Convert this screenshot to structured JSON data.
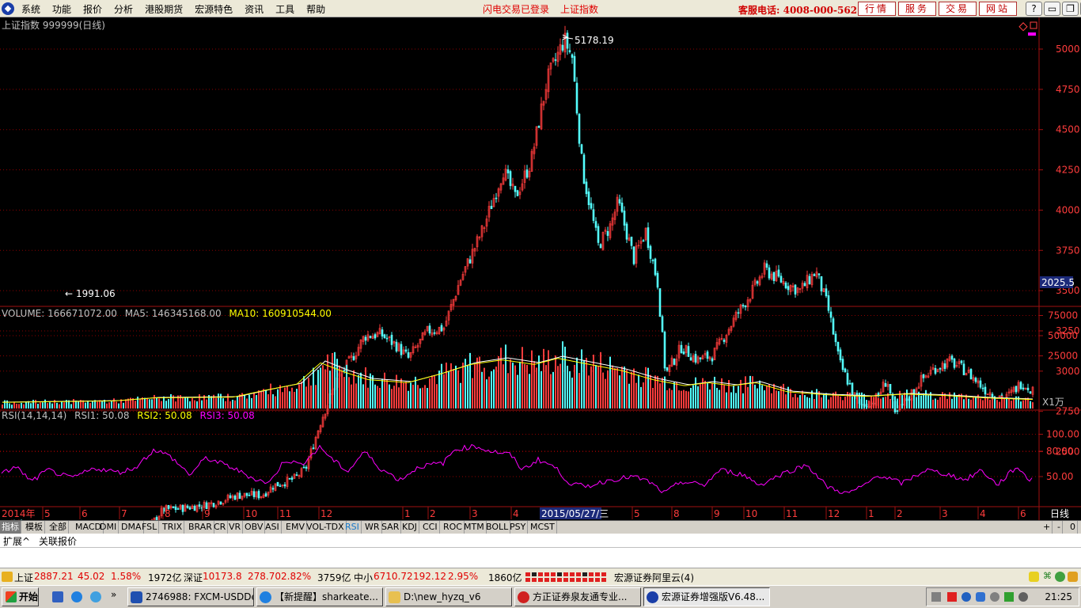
{
  "menu": {
    "items": [
      "系统",
      "功能",
      "报价",
      "分析",
      "港股期货",
      "宏源特色",
      "资讯",
      "工具",
      "帮助"
    ],
    "login_status": "闪电交易已登录",
    "current_index": "上证指数",
    "hotline": "客服电话: 4008-000-562",
    "nav_buttons": [
      "行情",
      "服务",
      "交易",
      "网站"
    ],
    "window_controls": [
      "?",
      "▭",
      "❐",
      "✕"
    ]
  },
  "kline": {
    "title": "上证指数 999999(日线)",
    "high_label": "5178.19",
    "low_label": "1991.06",
    "current_tag": "2025.5",
    "y_ticks": [
      "5000",
      "4750",
      "4500",
      "4250",
      "4000",
      "3750",
      "3500",
      "3250",
      "3000",
      "2750",
      "2500",
      "2000"
    ]
  },
  "volume": {
    "label_volume": "VOLUME: 166671072.00",
    "label_ma5": "MA5: 146345168.00",
    "label_ma10": "MA10: 160910544.00",
    "y_ticks": [
      "75000",
      "50000",
      "25000"
    ],
    "unit_tag": "X1万"
  },
  "rsi": {
    "label_main": "RSI(14,14,14)",
    "label_rsi1": "RSI1: 50.08",
    "label_rsi2": "RSI2: 50.08",
    "label_rsi3": "RSI3: 50.08",
    "y_ticks": [
      "100.00",
      "80.00",
      "50.00"
    ]
  },
  "time_axis": {
    "year_label": "2014年",
    "months": [
      "5",
      "6",
      "7",
      "8",
      "9",
      "10",
      "11",
      "12",
      "1",
      "2",
      "3",
      "4",
      "5",
      "8",
      "9",
      "10",
      "11",
      "12",
      "1",
      "2",
      "3",
      "4",
      "5",
      "6"
    ],
    "cursor_date": "2015/05/27/三",
    "period_label": "日线"
  },
  "tabs": {
    "items": [
      "指标",
      "模板",
      "全部",
      "MACD",
      "DMI",
      "DMA",
      "FSL",
      "TRIX",
      "BRAR",
      "CR",
      "VR",
      "OBV",
      "ASI",
      "EMV",
      "VOL-TDX",
      "RSI",
      "WR",
      "SAR",
      "KDJ",
      "CCI",
      "ROC",
      "MTM",
      "BOLL",
      "PSY",
      "MCST"
    ],
    "controls": [
      "+",
      "-",
      "0"
    ]
  },
  "ext_tabs": [
    "扩展^",
    "关联报价"
  ],
  "status": {
    "sh_name": "上证",
    "sh_value": "2887.21",
    "sh_change": "45.02",
    "sh_pct": "1.58%",
    "sh_amount": "1972亿",
    "sz_name": "深证",
    "sz_value": "10173.8",
    "sz_change": "278.70",
    "sz_pct": "2.82%",
    "sz_amount": "3759亿",
    "zx_name": "中小",
    "zx_value": "6710.72",
    "zx_change": "192.12",
    "zx_pct": "2.95%",
    "zx_amount": "1860亿",
    "server": "宏源证券阿里云(4)"
  },
  "colors": {
    "up": "#ff3c3c",
    "down": "#54ffff",
    "grid": "#8b0000",
    "ma5": "#ffffff",
    "ma10": "#ffff00",
    "rsi": "#ff00ff"
  },
  "taskbar": {
    "start": "开始",
    "more": "»",
    "windows": [
      "2746988: FXCM-USDDe...",
      "【新提醒】sharkeate...",
      "D:\\new_hyzq_v6",
      "方正证券泉友通专业...",
      "宏源证券增强版V6.48..."
    ],
    "clock": "21:25"
  }
}
